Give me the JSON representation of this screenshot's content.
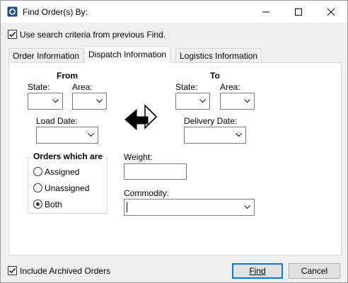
{
  "window": {
    "title": "Find Order(s) By:"
  },
  "top_checkbox": {
    "label": "Use search criteria from previous Find.",
    "checked": true
  },
  "tabs": [
    {
      "label": "Order Information",
      "active": false
    },
    {
      "label": "Dispatch Information",
      "active": true
    },
    {
      "label": "Logistics Information",
      "active": false
    }
  ],
  "from": {
    "heading": "From",
    "state_label": "State:",
    "area_label": "Area:",
    "load_date_label": "Load Date:"
  },
  "to": {
    "heading": "To",
    "state_label": "State:",
    "area_label": "Area:",
    "delivery_date_label": "Delivery Date:"
  },
  "orders_group": {
    "title": "Orders which are",
    "options": [
      "Assigned",
      "Unassigned",
      "Both"
    ],
    "selected": "Both"
  },
  "weight": {
    "label": "Weight:"
  },
  "commodity": {
    "label": "Commodity:"
  },
  "bottom_checkbox": {
    "label": "Include Archived Orders",
    "checked": true
  },
  "buttons": {
    "find": "Find",
    "cancel": "Cancel"
  },
  "icons": [
    "app-icon",
    "minimize-icon",
    "maximize-icon",
    "close-icon",
    "swap-arrows-icon",
    "chevron-down-icon",
    "checkmark-icon"
  ]
}
